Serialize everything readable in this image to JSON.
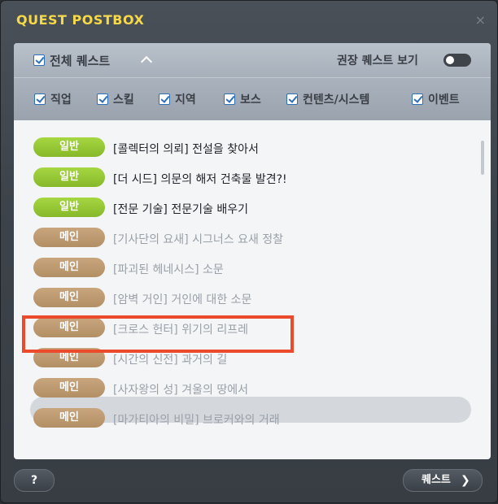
{
  "window": {
    "title": "QUEST POSTBOX",
    "close_glyph": "×"
  },
  "filters": {
    "all_quests_label": "전체 퀘스트",
    "recommended_label": "권장 퀘스트 보기",
    "recommended_on": false,
    "categories": [
      {
        "label": "직업",
        "checked": true
      },
      {
        "label": "스킬",
        "checked": true
      },
      {
        "label": "지역",
        "checked": true
      },
      {
        "label": "보스",
        "checked": true
      },
      {
        "label": "컨텐츠/시스템",
        "checked": true
      },
      {
        "label": "이벤트",
        "checked": true
      }
    ]
  },
  "quests": [
    {
      "type": "일반",
      "title": "[콜렉터의 의뢰] 전설을 찾아서",
      "style": "normal"
    },
    {
      "type": "일반",
      "title": "[더 시드] 의문의 해저 건축물 발견?!",
      "style": "normal"
    },
    {
      "type": "일반",
      "title": "[전문 기술] 전문기술 배우기",
      "style": "normal"
    },
    {
      "type": "메인",
      "title": "[기사단의 요새] 시그너스 요새 정찰",
      "style": "main"
    },
    {
      "type": "메인",
      "title": "[파괴된 헤네시스] 소문",
      "style": "main"
    },
    {
      "type": "메인",
      "title": "[암벽 거인] 거인에 대한 소문",
      "style": "main"
    },
    {
      "type": "메인",
      "title": "[크로스 헌터] 위기의 리프레",
      "style": "main"
    },
    {
      "type": "메인",
      "title": "[시간의 신전] 과거의 길",
      "style": "main"
    },
    {
      "type": "메인",
      "title": "[사자왕의 성] 겨울의 땅에서",
      "style": "main"
    },
    {
      "type": "메인",
      "title": "[마가티아의 비밀] 브로커와의 거래",
      "style": "main"
    }
  ],
  "selected_index": 6,
  "footer": {
    "help_label": "?",
    "quest_label": "퀘스트",
    "quest_arrow": "❯"
  },
  "colors": {
    "title": "#f6d94a",
    "normal_badge": "#97c735",
    "main_badge": "#bd9a70",
    "highlight": "#ec4a2c"
  }
}
